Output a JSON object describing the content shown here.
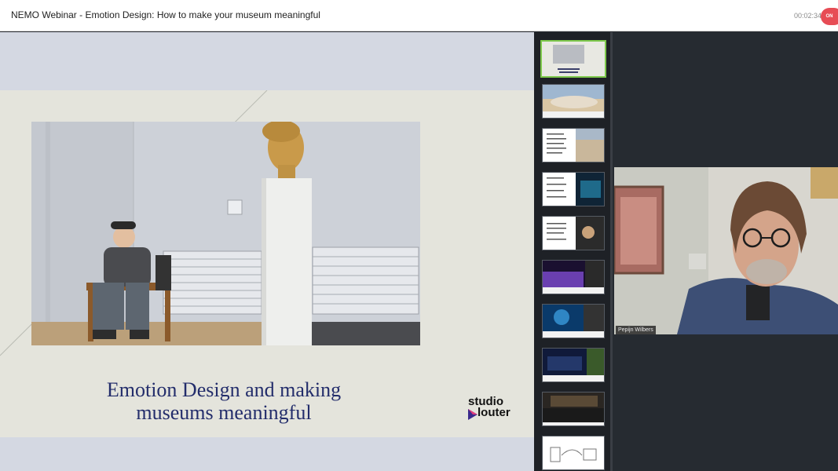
{
  "header": {
    "title": "NEMO Webinar - Emotion Design: How to make your museum meaningful",
    "timer": "00:02:34",
    "live_label": "ON"
  },
  "slide": {
    "title": "Emotion Design and making museums meaningful",
    "logo_line1": "studio",
    "logo_line2": "louter"
  },
  "video": {
    "participant_name": "Pepijn Wilbers"
  },
  "colors": {
    "accent_live": "#e74c55",
    "active_thumb_border": "#7ec94c",
    "slide_title": "#232d6b"
  }
}
